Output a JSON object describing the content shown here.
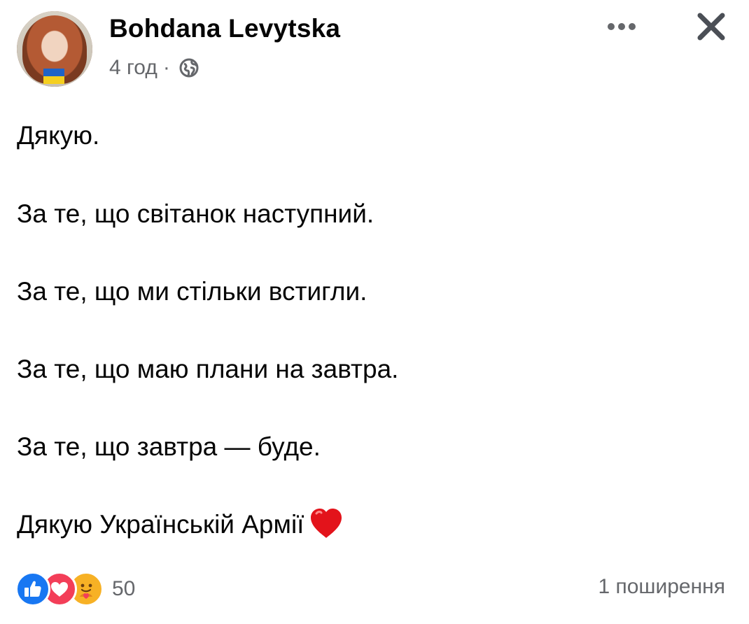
{
  "author": {
    "name": "Bohdana Levytska",
    "time": "4 год",
    "separator": "·"
  },
  "header_icons": {
    "more": "more-horizontal-icon",
    "close": "close-icon",
    "audience": "globe-icon"
  },
  "post": {
    "lines": [
      "Дякую.",
      "За те, що світанок наступний.",
      "За те, що ми стільки встигли.",
      "За те, що маю плани на завтра.",
      "За те, що завтра — буде.",
      "Дякую Українській Армії"
    ],
    "trailing_emoji": "heart-icon"
  },
  "footer": {
    "reactions": [
      "like",
      "love",
      "care"
    ],
    "reaction_count": "50",
    "shares": "1 поширення"
  },
  "colors": {
    "text": "#050505",
    "secondary": "#65676b",
    "like": "#1877f2",
    "love": "#f33e58",
    "care": "#f7b125",
    "heart": "#e3131b"
  }
}
